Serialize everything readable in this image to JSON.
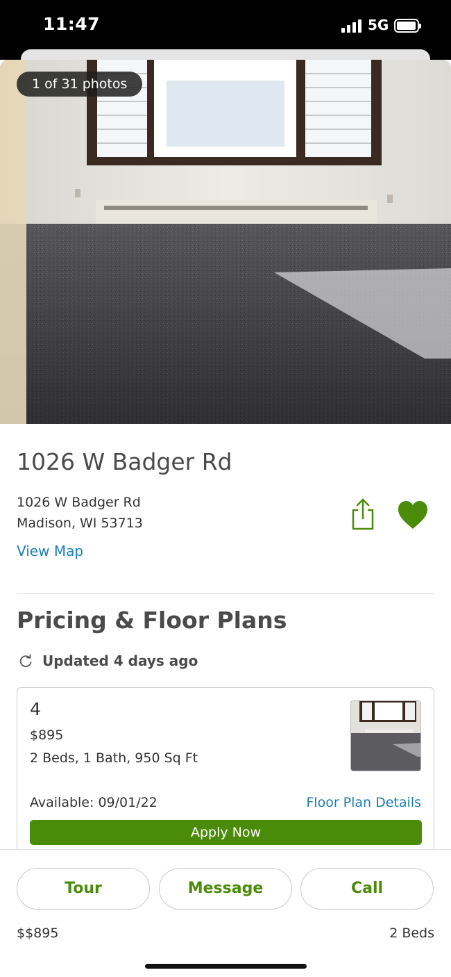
{
  "status_bar": {
    "time": "11:47",
    "network": "5G"
  },
  "gallery": {
    "counter": "1 of 31 photos"
  },
  "listing": {
    "title": "1026 W Badger Rd",
    "address_line1": "1026 W Badger Rd",
    "address_line2": "Madison, WI 53713",
    "view_map": "View Map",
    "share_icon": "share-icon",
    "favorite_icon": "heart-icon"
  },
  "pricing": {
    "title": "Pricing & Floor Plans",
    "updated": "Updated 4 days ago",
    "floor_plan": {
      "unit": "4",
      "price": "$895",
      "specs": "2 Beds, 1 Bath, 950 Sq Ft",
      "available": "Available: 09/01/22",
      "details_link": "Floor Plan Details",
      "apply_label": "Apply Now"
    }
  },
  "bottom_bar": {
    "tour_label": "Tour",
    "message_label": "Message",
    "call_label": "Call",
    "price": "$$895",
    "beds": "2 Beds"
  },
  "colors": {
    "accent_green": "#4b8b0a",
    "link_blue": "#1b7fb0"
  }
}
